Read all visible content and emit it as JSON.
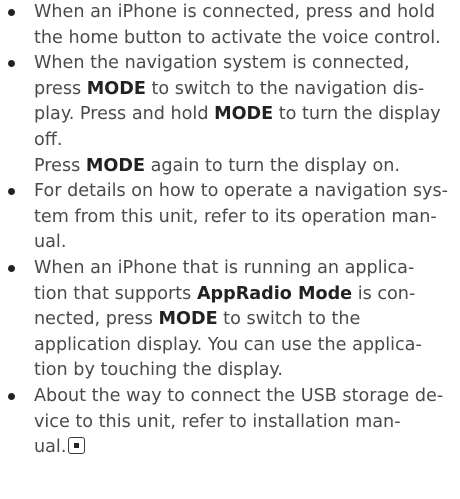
{
  "items": [
    {
      "lines": [
        "When an iPhone is connected, press and hold",
        "the home button to activate the voice control."
      ]
    },
    {
      "l1": "When the navigation system is connected,",
      "l2_pre": "press ",
      "l2_bold": "MODE",
      "l2_post": " to switch to the navigation dis-",
      "l3_pre": "play. Press and hold ",
      "l3_bold": "MODE",
      "l3_post": " to turn the display",
      "l4": "off.",
      "l5_pre": "Press ",
      "l5_bold": "MODE",
      "l5_post": " again to turn the display on."
    },
    {
      "lines": [
        "For details on how to operate a navigation sys-",
        "tem from this unit, refer to its operation man-",
        "ual."
      ]
    },
    {
      "l1": "When an iPhone that is running an applica-",
      "l2_pre": "tion that supports ",
      "l2_bold": "AppRadio Mode",
      "l2_post": " is con-",
      "l3_pre": "nected, press ",
      "l3_bold": "MODE",
      "l3_post": " to switch to the",
      "l4": "application display. You can use the applica-",
      "l5": "tion by touching the display."
    },
    {
      "lines": [
        "About the way to connect the USB storage de-",
        "vice to this unit, refer to installation man-",
        "ual."
      ]
    }
  ],
  "icons": {
    "end_mark": "end-of-section-icon"
  }
}
